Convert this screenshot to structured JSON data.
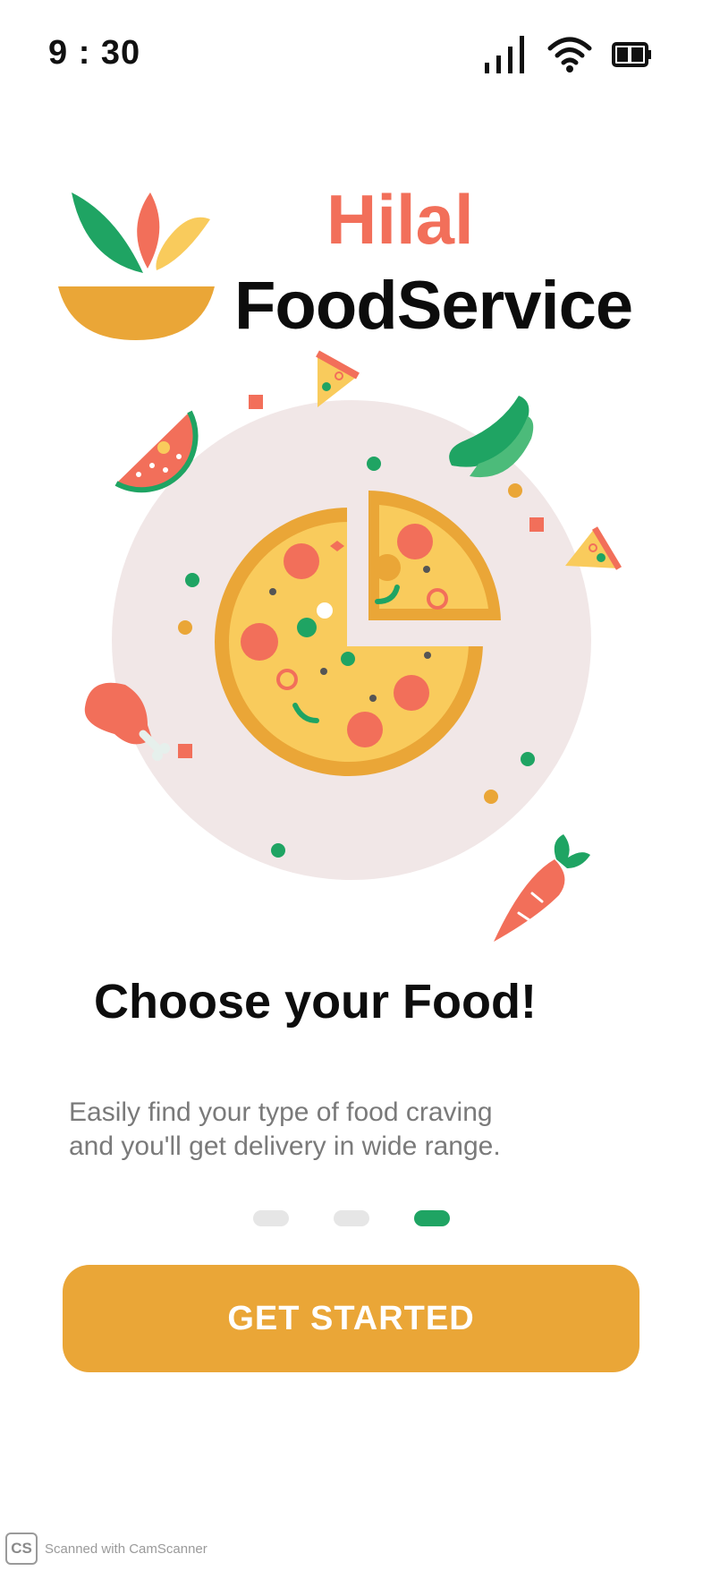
{
  "status_bar": {
    "time": "9 : 30",
    "icons": [
      "cellular-signal-icon",
      "wifi-icon",
      "battery-icon"
    ]
  },
  "brand": {
    "logo_icon": "salad-bowl-logo-icon",
    "name_line1": "Hilal",
    "name_line2": "FoodService",
    "accent_color": "#F26F5A"
  },
  "illustration": {
    "icons": [
      "pizza-icon",
      "pizza-slice-icon",
      "watermelon-icon",
      "pepper-icon",
      "chicken-leg-icon",
      "carrot-icon"
    ]
  },
  "onboarding": {
    "title": "Choose your Food!",
    "description_line1": "Easily find your type of food craving",
    "description_line2": "and you'll get delivery in wide range.",
    "page_count": 3,
    "active_page": 3
  },
  "cta": {
    "label": "GET STARTED",
    "color": "#EAA637"
  },
  "watermark": {
    "badge": "CS",
    "text": "Scanned with CamScanner"
  },
  "colors": {
    "primary_green": "#1FA463",
    "yellow": "#F9CB5C",
    "orange": "#EAA637",
    "red": "#F26F5A",
    "plate": "#F1E7E7"
  }
}
